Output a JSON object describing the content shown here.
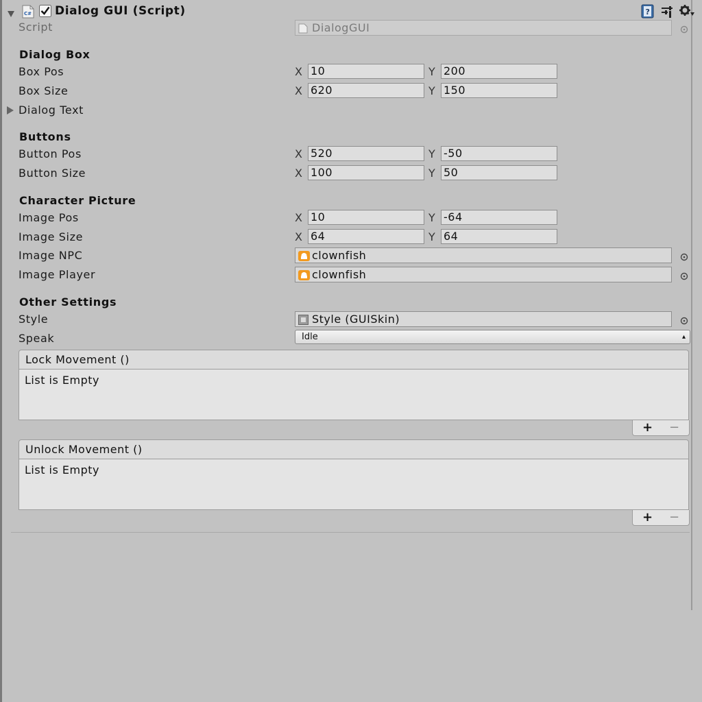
{
  "component": {
    "title": "Dialog GUI (Script)",
    "enabled": true,
    "script_label": "Script",
    "script_value": "DialogGUI"
  },
  "sections": {
    "dialog_box": "Dialog Box",
    "buttons": "Buttons",
    "character_picture": "Character Picture",
    "other_settings": "Other Settings"
  },
  "axes": {
    "x": "X",
    "y": "Y"
  },
  "fields": {
    "box_pos": {
      "label": "Box Pos",
      "x": "10",
      "y": "200"
    },
    "box_size": {
      "label": "Box Size",
      "x": "620",
      "y": "150"
    },
    "dialog_text": {
      "label": "Dialog Text"
    },
    "button_pos": {
      "label": "Button Pos",
      "x": "520",
      "y": "-50"
    },
    "button_size": {
      "label": "Button Size",
      "x": "100",
      "y": "50"
    },
    "image_pos": {
      "label": "Image Pos",
      "x": "10",
      "y": "-64"
    },
    "image_size": {
      "label": "Image Size",
      "x": "64",
      "y": "64"
    },
    "image_npc": {
      "label": "Image NPC",
      "value": "clownfish"
    },
    "image_player": {
      "label": "Image Player",
      "value": "clownfish"
    },
    "style": {
      "label": "Style",
      "value": "Style (GUISkin)"
    },
    "speak": {
      "label": "Speak",
      "value": "Idle"
    }
  },
  "events": {
    "lock": {
      "title": "Lock Movement ()",
      "empty": "List is Empty",
      "add": "+",
      "remove": "−"
    },
    "unlock": {
      "title": "Unlock Movement ()",
      "empty": "List is Empty",
      "add": "+",
      "remove": "−"
    }
  },
  "icons": {
    "component": "csharp-script-icon",
    "help": "help-book-icon",
    "preset": "preset-sliders-icon",
    "settings": "gear-icon",
    "sprite": "sprite-icon",
    "object_picker": "object-picker-icon"
  },
  "colors": {
    "panel_bg": "#c2c2c2",
    "field_bg": "#dedede",
    "sprite_icon": "#f29a1f",
    "help_icon": "#3d6fa8"
  }
}
